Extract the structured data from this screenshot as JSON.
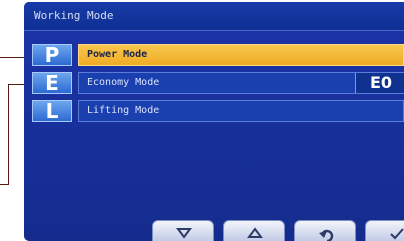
{
  "window": {
    "title": "Working Mode"
  },
  "modes": [
    {
      "key": "P",
      "label": "Power Mode",
      "selected": true
    },
    {
      "key": "E",
      "label": "Economy Mode",
      "value": "E0",
      "selected": false
    },
    {
      "key": "L",
      "label": "Lifting Mode",
      "selected": false
    }
  ],
  "softkeys": [
    {
      "icon": "down-triangle-icon"
    },
    {
      "icon": "up-triangle-icon"
    },
    {
      "icon": "return-icon"
    },
    {
      "icon": "checkmark-icon"
    }
  ],
  "colors": {
    "screen_bg": "#18319e",
    "selected_row": "#f0ac23",
    "badge": "#2c6ad3"
  }
}
